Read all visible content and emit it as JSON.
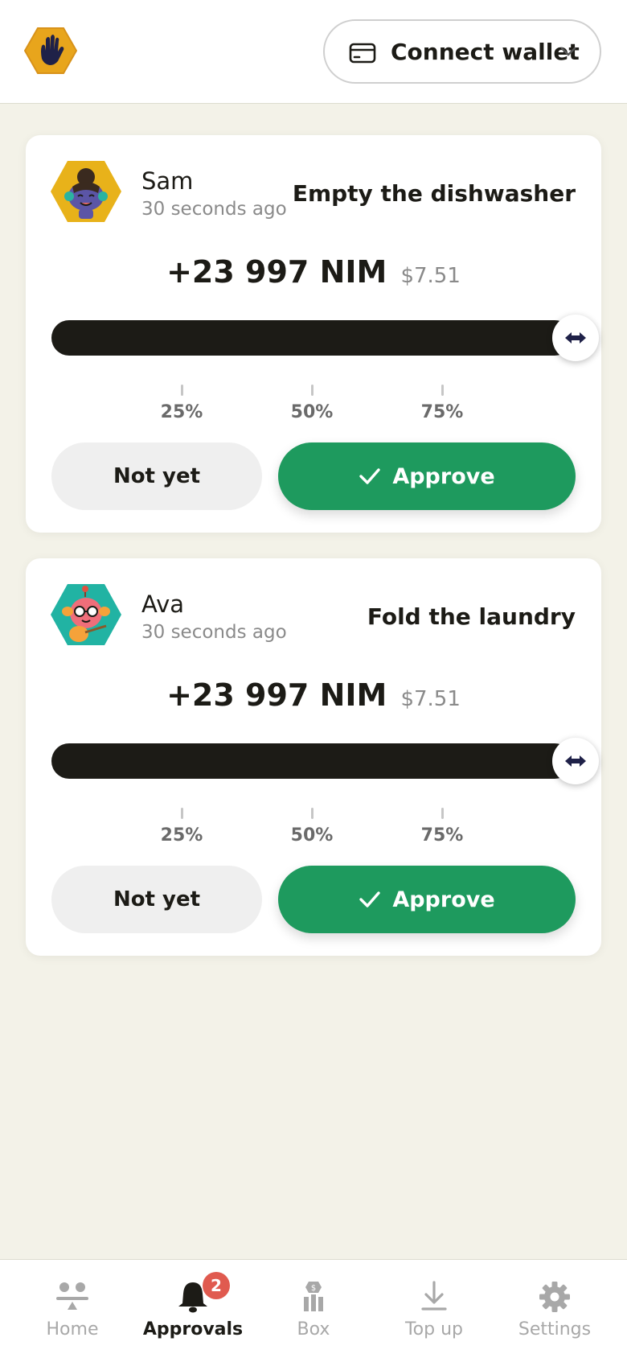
{
  "header": {
    "wallet_label": "Connect wallet",
    "icons": [
      "hand-logo-icon",
      "wallet-card-icon",
      "chevron-down-icon"
    ]
  },
  "approvals": [
    {
      "kid_name": "Sam",
      "time_ago": "30 seconds ago",
      "task": "Empty the dishwasher",
      "amount": "+23 997 NIM",
      "fiat": "$7.51",
      "slider_fraction": 1.0,
      "ticks": [
        "25%",
        "50%",
        "75%"
      ],
      "not_yet_label": "Not yet",
      "approve_label": "Approve",
      "avatar_color": "#e8b21a"
    },
    {
      "kid_name": "Ava",
      "time_ago": "30 seconds ago",
      "task": "Fold the laundry",
      "amount": "+23 997 NIM",
      "fiat": "$7.51",
      "slider_fraction": 1.0,
      "ticks": [
        "25%",
        "50%",
        "75%"
      ],
      "not_yet_label": "Not yet",
      "approve_label": "Approve",
      "avatar_color": "#21b3a3"
    }
  ],
  "nav": {
    "items": [
      {
        "label": "Home",
        "icon": "home-icon"
      },
      {
        "label": "Approvals",
        "icon": "bell-icon",
        "badge": "2",
        "active": true
      },
      {
        "label": "Box",
        "icon": "box-icon"
      },
      {
        "label": "Top up",
        "icon": "download-icon"
      },
      {
        "label": "Settings",
        "icon": "gear-icon"
      }
    ]
  },
  "colors": {
    "background": "#f3f2e8",
    "approve_green": "#1e9a5e",
    "slider_dark": "#1c1b16",
    "badge_red": "#e05a4f",
    "logo_amber": "#e8a51c"
  }
}
